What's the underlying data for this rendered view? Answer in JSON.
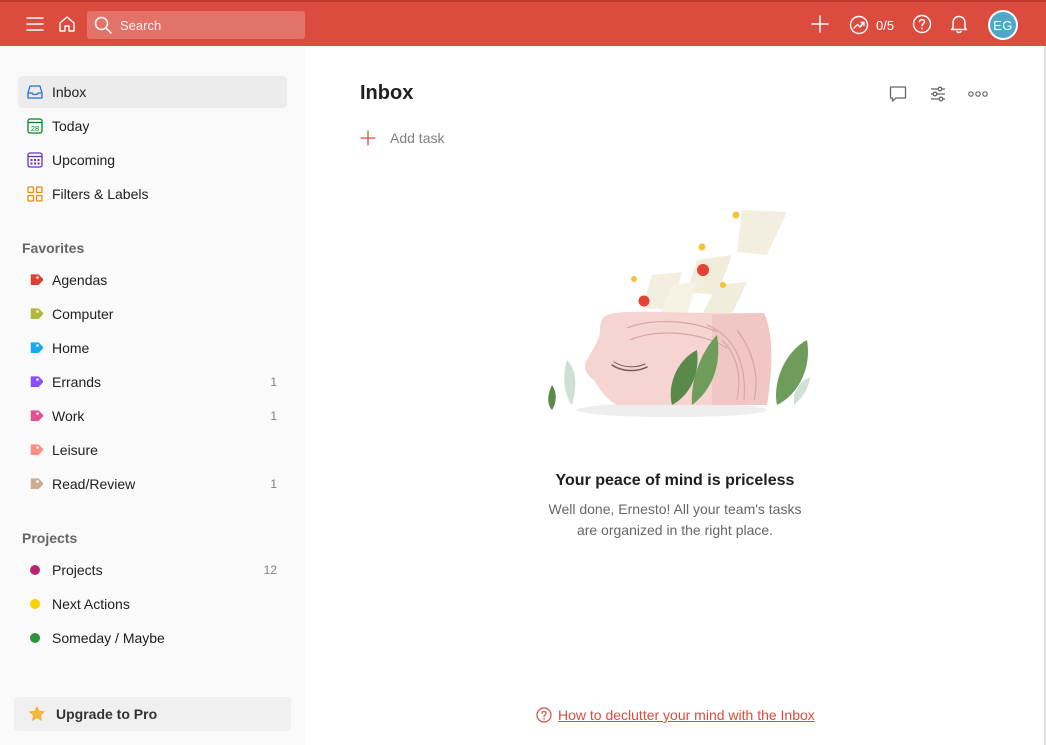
{
  "topbar": {
    "search_placeholder": "Search",
    "karma_count": "0/5",
    "avatar_initials": "EG",
    "icons": [
      "menu-icon",
      "home-icon",
      "search-icon",
      "plus-icon",
      "productivity-icon",
      "help-icon",
      "bell-icon"
    ],
    "bg_color": "#db4c3f"
  },
  "sidebar": {
    "nav": [
      {
        "label": "Inbox",
        "icon": "inbox-icon",
        "active": true
      },
      {
        "label": "Today",
        "icon": "calendar-today-icon",
        "day": "28"
      },
      {
        "label": "Upcoming",
        "icon": "calendar-upcoming-icon"
      },
      {
        "label": "Filters & Labels",
        "icon": "filters-labels-icon"
      }
    ],
    "favorites_heading": "Favorites",
    "favorites": [
      {
        "label": "Agendas",
        "count": "",
        "color": "#db4035"
      },
      {
        "label": "Computer",
        "count": "",
        "color": "#afb83b"
      },
      {
        "label": "Home",
        "count": "",
        "color": "#14aaf5"
      },
      {
        "label": "Errands",
        "count": "1",
        "color": "#884dff"
      },
      {
        "label": "Work",
        "count": "1",
        "color": "#e05194"
      },
      {
        "label": "Leisure",
        "count": "",
        "color": "#ff8d85"
      },
      {
        "label": "Read/Review",
        "count": "1",
        "color": "#ccac93"
      }
    ],
    "projects_heading": "Projects",
    "projects": [
      {
        "label": "Projects",
        "count": "12",
        "color": "#b8256f"
      },
      {
        "label": "Next Actions",
        "count": "",
        "color": "#fad000"
      },
      {
        "label": "Someday / Maybe",
        "count": "",
        "color": "#299438"
      }
    ],
    "upgrade_label": "Upgrade to Pro"
  },
  "main": {
    "title": "Inbox",
    "add_task_label": "Add task",
    "empty_title": "Your peace of mind is priceless",
    "empty_desc": "Well done, Ernesto! All your team's tasks are organized in the right place.",
    "help_link": "How to declutter your mind with the Inbox",
    "header_icons": [
      "comment-icon",
      "view-options-icon",
      "more-icon"
    ]
  }
}
